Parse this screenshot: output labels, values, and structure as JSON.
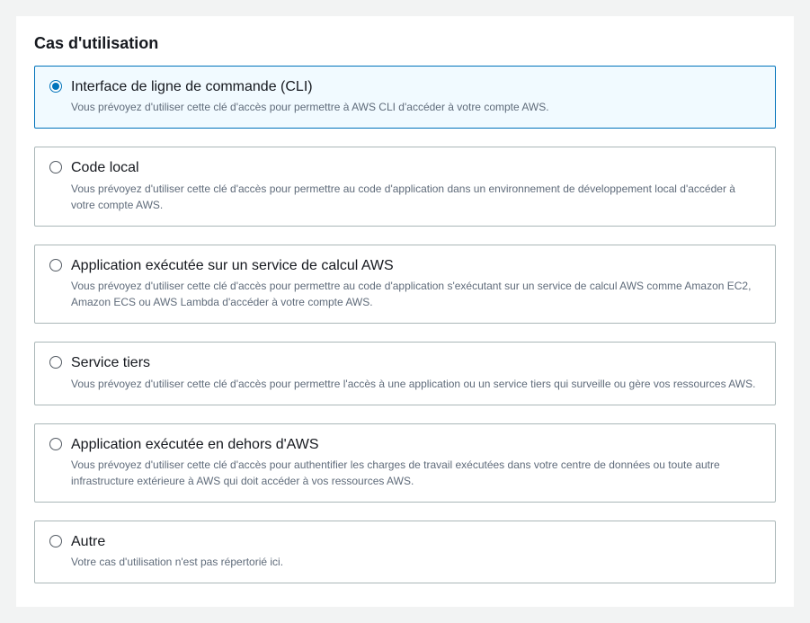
{
  "section_title": "Cas d'utilisation",
  "options": [
    {
      "title": "Interface de ligne de commande (CLI)",
      "desc": "Vous prévoyez d'utiliser cette clé d'accès pour permettre à AWS CLI d'accéder à votre compte AWS."
    },
    {
      "title": "Code local",
      "desc": "Vous prévoyez d'utiliser cette clé d'accès pour permettre au code d'application dans un environnement de développement local d'accéder à votre compte AWS."
    },
    {
      "title": "Application exécutée sur un service de calcul AWS",
      "desc": "Vous prévoyez d'utiliser cette clé d'accès pour permettre au code d'application s'exécutant sur un service de calcul AWS comme Amazon EC2, Amazon ECS ou AWS Lambda d'accéder à votre compte AWS."
    },
    {
      "title": "Service tiers",
      "desc": "Vous prévoyez d'utiliser cette clé d'accès pour permettre l'accès à une application ou un service tiers qui surveille ou gère vos ressources AWS."
    },
    {
      "title": "Application exécutée en dehors d'AWS",
      "desc": "Vous prévoyez d'utiliser cette clé d'accès pour authentifier les charges de travail exécutées dans votre centre de données ou toute autre infrastructure extérieure à AWS qui doit accéder à vos ressources AWS."
    },
    {
      "title": "Autre",
      "desc": "Votre cas d'utilisation n'est pas répertorié ici."
    }
  ]
}
